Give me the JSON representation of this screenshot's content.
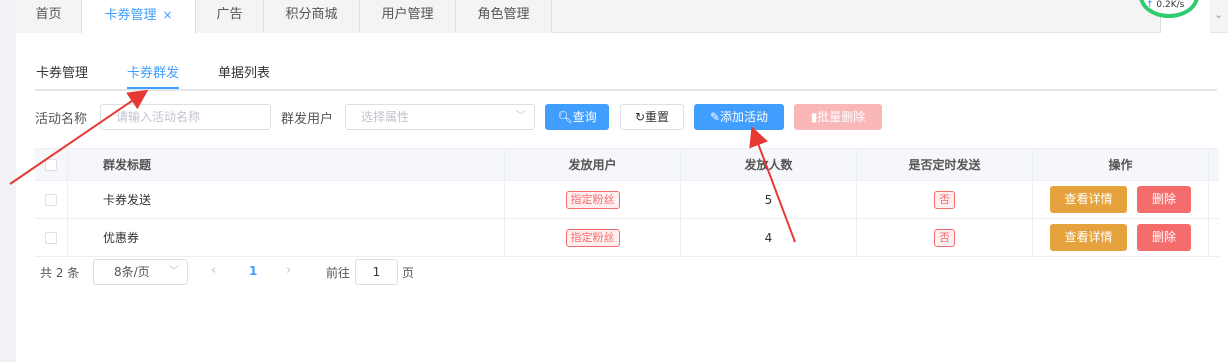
{
  "nav_tabs": [
    {
      "label": "首页"
    },
    {
      "label": "卡券管理",
      "close": "×"
    },
    {
      "label": "广告"
    },
    {
      "label": "积分商城"
    },
    {
      "label": "用户管理"
    },
    {
      "label": "角色管理"
    }
  ],
  "net_speed": {
    "arrow": "↑",
    "value": "0.2K/s"
  },
  "sub_tabs": [
    "卡券管理",
    "卡券群发",
    "单据列表"
  ],
  "filters": {
    "activity_label": "活动名称",
    "activity_placeholder": "请输入活动名称",
    "users_label": "群发用户",
    "users_placeholder": "选择属性"
  },
  "buttons": {
    "query": "查询",
    "reset": "重置",
    "add": "添加活动",
    "batch_delete": "批量删除"
  },
  "table": {
    "columns": [
      "群发标题",
      "发放用户",
      "发放人数",
      "是否定时发送",
      "操作"
    ],
    "rows": [
      {
        "title": "卡券发送",
        "users": "指定粉丝",
        "count": "5",
        "scheduled": "否"
      },
      {
        "title": "优惠券",
        "users": "指定粉丝",
        "count": "4",
        "scheduled": "否"
      }
    ],
    "action_detail": "查看详情",
    "action_delete": "删除"
  },
  "pager": {
    "total": "共 2 条",
    "page_size": "8条/页",
    "prev": "‹",
    "current_page": "1",
    "next": "›",
    "goto": "前往",
    "goto_value": "1",
    "unit": "页"
  },
  "colors": {
    "accent": "#409eff",
    "danger": "#f56c6c",
    "warning": "#e6a23c",
    "annotation": "#e53935"
  }
}
